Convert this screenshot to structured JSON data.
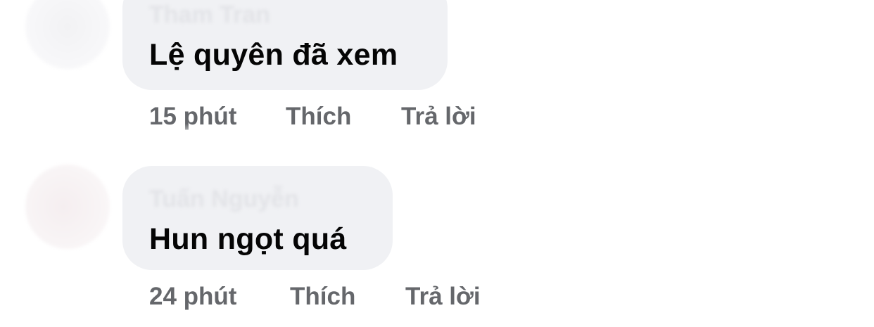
{
  "comments": [
    {
      "author": "Tham Tran",
      "text": "Lệ quyên đã xem",
      "time": "15 phút",
      "like_label": "Thích",
      "reply_label": "Trả lời"
    },
    {
      "author": "Tuấn Nguyễn",
      "text": "Hun ngọt quá",
      "time": "24 phút",
      "like_label": "Thích",
      "reply_label": "Trả lời"
    }
  ],
  "colors": {
    "bubble": "#f0f1f4",
    "text": "#050505",
    "meta": "#65676b"
  }
}
